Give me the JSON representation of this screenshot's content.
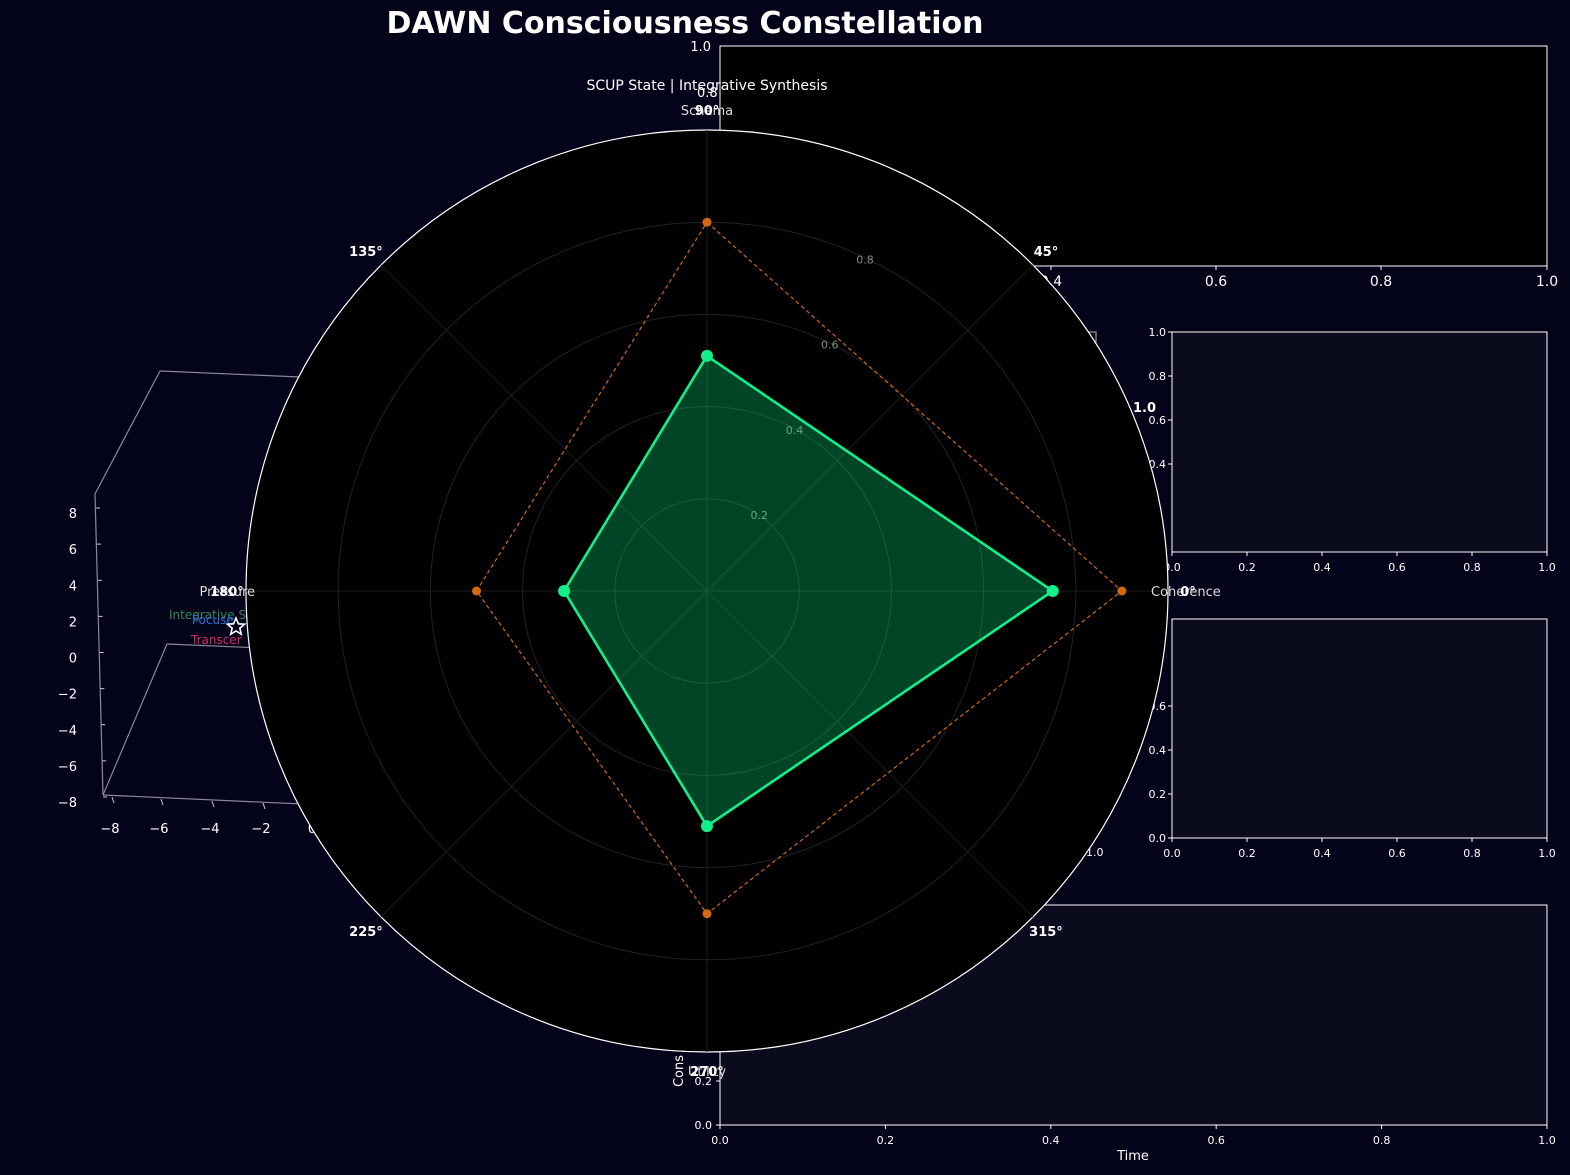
{
  "title": "DAWN Consciousness Constellation",
  "colors": {
    "background": "#03031a",
    "panel": "#0b0b1e",
    "radar_fill": "#00ff8c",
    "radar_line": "#12f08a",
    "target_line": "#d2690f",
    "trajectory": [
      "#2e8b57",
      "#2f6fdc",
      "#dc2a64"
    ],
    "axes": "#ffffff"
  },
  "chart_data": [
    {
      "type": "radar",
      "title": "SCUP State | Integrative Synthesis",
      "axes": [
        "Schema",
        "Coherence",
        "Utility",
        "Pressure"
      ],
      "radial_ticks": [
        "0.2",
        "0.4",
        "0.6",
        "0.8"
      ],
      "radial_range": [
        0,
        1.0
      ],
      "angle_ticks": [
        "0°",
        "45°",
        "90°",
        "135°",
        "180°",
        "225°",
        "270°",
        "315°"
      ],
      "series": [
        {
          "role": "current",
          "values": [
            0.51,
            0.75,
            0.51,
            0.31
          ]
        },
        {
          "role": "target",
          "values": [
            0.8,
            0.9,
            0.7,
            0.5
          ]
        }
      ]
    },
    {
      "type": "scatter3d",
      "zticks": [
        "8",
        "6",
        "4",
        "2",
        "0",
        "−2",
        "−4",
        "−6",
        "−8"
      ],
      "xticks": [
        "−8",
        "−6",
        "−4",
        "−2",
        "0"
      ],
      "legend": [
        "Integrative S",
        "Focuse",
        "Transcer"
      ],
      "point": {
        "x": -2.5,
        "y": 0,
        "z": 1.8
      }
    },
    {
      "type": "empty",
      "xticks": [
        "0.4",
        "0.6",
        "0.8",
        "1.0"
      ],
      "ytop_tick": "1.0",
      "ylabel_peek": "0.8"
    },
    {
      "type": "empty",
      "xticks": [
        "0.0",
        "0.2",
        "0.4",
        "0.6",
        "0.8",
        "1.0"
      ],
      "yticks": [
        "1.0",
        "0.8",
        "0.6",
        "0.4"
      ],
      "peek_labels": [
        "1.0"
      ]
    },
    {
      "type": "empty",
      "xticks": [
        "0.0",
        "0.2",
        "0.4",
        "0.6",
        "0.8",
        "1.0"
      ],
      "yticks": [
        "0.0",
        "0.2",
        "0.4",
        "0.6"
      ],
      "peek_labels": [
        "1.0"
      ]
    },
    {
      "type": "line",
      "xlabel": "Time",
      "ylabel": "Cons",
      "xticks": [
        "0.0",
        "0.2",
        "0.4",
        "0.6",
        "0.8",
        "1.0"
      ],
      "yticks": [
        "0.0",
        "0.2"
      ],
      "series": []
    }
  ]
}
